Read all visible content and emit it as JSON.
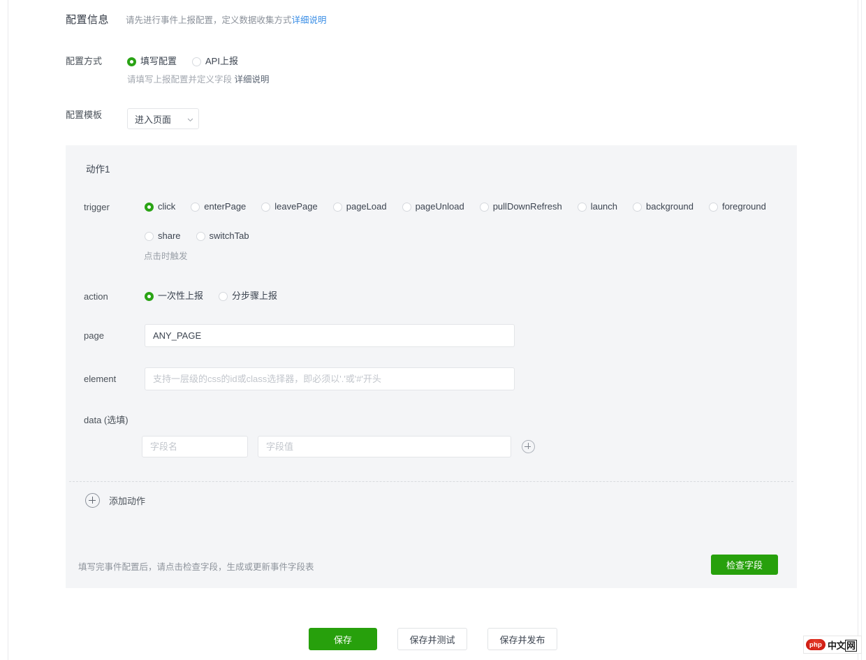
{
  "header": {
    "title": "配置信息",
    "subtitle": "请先进行事件上报配置，定义数据收集方式",
    "sub_link": "详细说明"
  },
  "config_mode": {
    "label": "配置方式",
    "options": [
      {
        "label": "填写配置",
        "checked": true
      },
      {
        "label": "API上报",
        "checked": false
      }
    ],
    "help": "请填写上报配置并定义字段",
    "help_link": "详细说明"
  },
  "config_template": {
    "label": "配置模板",
    "value": "进入页面",
    "caret_icon": "chevron-down-icon"
  },
  "action_card": {
    "title": "动作1",
    "trigger": {
      "label": "trigger",
      "row1": [
        {
          "label": "click",
          "checked": true
        },
        {
          "label": "enterPage",
          "checked": false
        },
        {
          "label": "leavePage",
          "checked": false
        },
        {
          "label": "pageLoad",
          "checked": false
        },
        {
          "label": "pageUnload",
          "checked": false
        },
        {
          "label": "pullDownRefresh",
          "checked": false
        },
        {
          "label": "launch",
          "checked": false
        },
        {
          "label": "background",
          "checked": false
        },
        {
          "label": "foreground",
          "checked": false
        }
      ],
      "row2": [
        {
          "label": "share",
          "checked": false
        },
        {
          "label": "switchTab",
          "checked": false
        }
      ],
      "help": "点击时触发"
    },
    "action": {
      "label": "action",
      "options": [
        {
          "label": "一次性上报",
          "checked": true
        },
        {
          "label": "分步骤上报",
          "checked": false
        }
      ]
    },
    "page": {
      "label": "page",
      "value": "ANY_PAGE",
      "placeholder": ""
    },
    "element": {
      "label": "element",
      "value": "",
      "placeholder": "支持一层级的css的id或class选择器，即必须以'.'或'#'开头"
    },
    "data": {
      "label": "data (选填)",
      "key_placeholder": "字段名",
      "key_value": "",
      "value_placeholder": "字段值",
      "value_value": "",
      "add_icon": "plus-circle-icon"
    },
    "add_action": {
      "icon": "plus-circle-icon",
      "label": "添加动作"
    },
    "footer_note": "填写完事件配置后，请点击检查字段，生成或更新事件字段表",
    "check_button": "检查字段"
  },
  "bottom_bar": {
    "save": "保存",
    "save_and_test": "保存并测试",
    "save_and_publish": "保存并发布"
  },
  "watermark": {
    "logo": "php",
    "text_a": "中文",
    "text_b": "网"
  },
  "colors": {
    "accent_green": "#27a00c",
    "link_blue": "#3a8ee6",
    "card_bg": "#f4f5f7"
  }
}
